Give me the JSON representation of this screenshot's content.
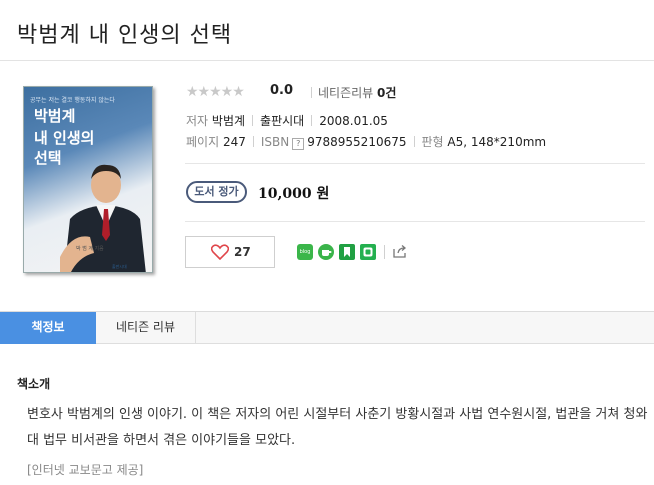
{
  "book": {
    "title": "박범계 내 인생의 선택",
    "cover": {
      "tagline": "공무는 저는 결코 행동하지 않는다",
      "title_line1": "박범계",
      "title_line2": "내 인생의",
      "title_line3": "선택",
      "author": "박 범 계 지음",
      "publisher": "출판시대"
    },
    "rating": "0.0",
    "review_label": "네티즌리뷰",
    "review_count": "0건",
    "author_label": "저자",
    "author": "박범계",
    "publisher": "출판시대",
    "date": "2008.01.05",
    "pages_label": "페이지",
    "pages": "247",
    "isbn_label": "ISBN",
    "isbn": "9788955210675",
    "format_label": "판형",
    "format": "A5, 148*210mm",
    "price_badge": "도서 정가",
    "price": "10,000 원",
    "likes": "27"
  },
  "share_icons": [
    "blog-icon",
    "cafe-icon",
    "bookmark-icon",
    "band-icon",
    "share-out-icon"
  ],
  "tabs": [
    {
      "label": "책정보",
      "active": true
    },
    {
      "label": "네티즌 리뷰",
      "active": false
    }
  ],
  "intro": {
    "heading": "책소개",
    "body": "변호사 박범계의 인생 이야기. 이 책은 저자의 어린 시절부터 사춘기 방황시절과 사법 연수원시절, 법관을 거쳐 청와대 법무 비서관을 하면서 겪은 이야기들을 모았다.",
    "source": "[인터넷 교보문고 제공]"
  },
  "colors": {
    "tab_active": "#4a90e2",
    "heart": "#e0464b",
    "badge": "#4a5a7a"
  }
}
